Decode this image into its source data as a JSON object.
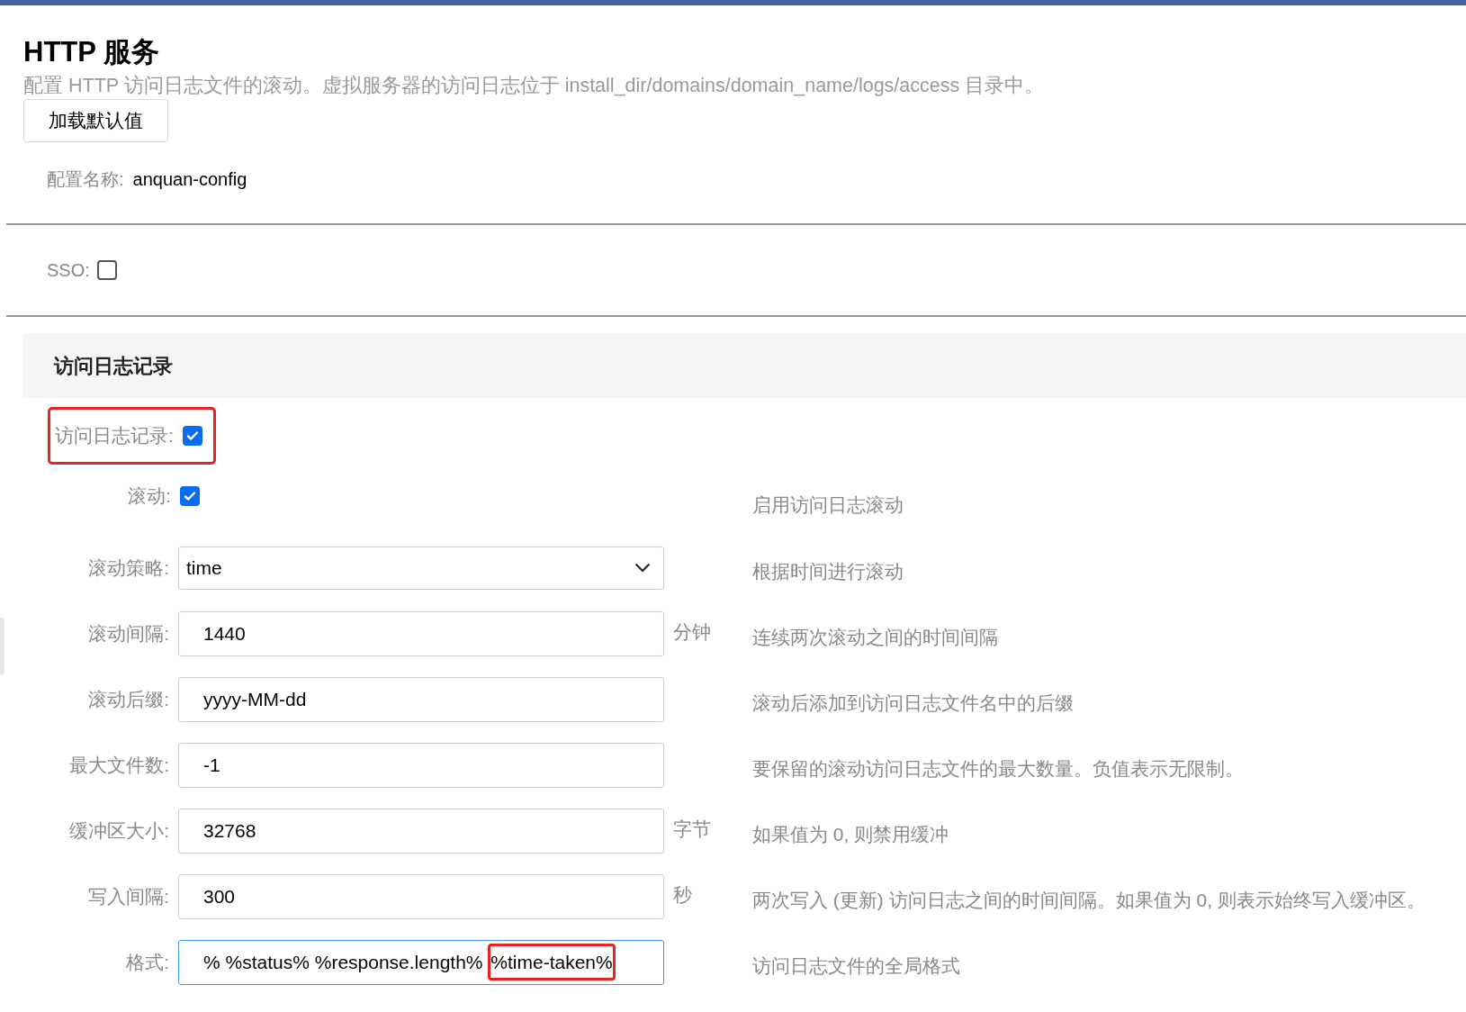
{
  "title": "HTTP 服务",
  "description": "配置 HTTP 访问日志文件的滚动。虚拟服务器的访问日志位于 install_dir/domains/domain_name/logs/access 目录中。",
  "load_defaults_button": "加载默认值",
  "config_name": {
    "label": "配置名称:",
    "value": "anquan-config"
  },
  "sso": {
    "label": "SSO:",
    "checked": false
  },
  "section": {
    "title": "访问日志记录",
    "rows": [
      {
        "kind": "checkbox",
        "label": "访问日志记录:",
        "checked": true,
        "highlighted": true
      },
      {
        "kind": "checkbox",
        "label": "滚动:",
        "checked": true,
        "description": "启用访问日志滚动"
      },
      {
        "kind": "select",
        "label": "滚动策略:",
        "value": "time",
        "description": "根据时间进行滚动"
      },
      {
        "kind": "text",
        "label": "滚动间隔:",
        "value_parts": [
          {
            "text": "1440",
            "highlighted": false
          }
        ],
        "unit": "分钟",
        "description": "连续两次滚动之间的时间间隔",
        "focused": false
      },
      {
        "kind": "text",
        "label": "滚动后缀:",
        "value_parts": [
          {
            "text": "yyyy-MM-dd",
            "highlighted": false
          }
        ],
        "description": "滚动后添加到访问日志文件名中的后缀",
        "focused": false
      },
      {
        "kind": "text",
        "label": "最大文件数:",
        "value_parts": [
          {
            "text": "-1",
            "highlighted": false
          }
        ],
        "description": "要保留的滚动访问日志文件的最大数量。负值表示无限制。",
        "focused": false
      },
      {
        "kind": "text",
        "label": "缓冲区大小:",
        "value_parts": [
          {
            "text": "32768",
            "highlighted": false
          }
        ],
        "unit": "字节",
        "description": "如果值为 0, 则禁用缓冲",
        "focused": false
      },
      {
        "kind": "text",
        "label": "写入间隔:",
        "value_parts": [
          {
            "text": "300",
            "highlighted": false
          }
        ],
        "unit": "秒",
        "description": "两次写入 (更新) 访问日志之间的时间间隔。如果值为 0, 则表示始终写入缓冲区。",
        "focused": false
      },
      {
        "kind": "text",
        "label": "格式:",
        "value_parts": [
          {
            "text": "% %status% %response.length% ",
            "highlighted": false
          },
          {
            "text": "%time-taken%",
            "highlighted": true
          }
        ],
        "description": "访问日志文件的全局格式",
        "focused": true
      }
    ]
  }
}
